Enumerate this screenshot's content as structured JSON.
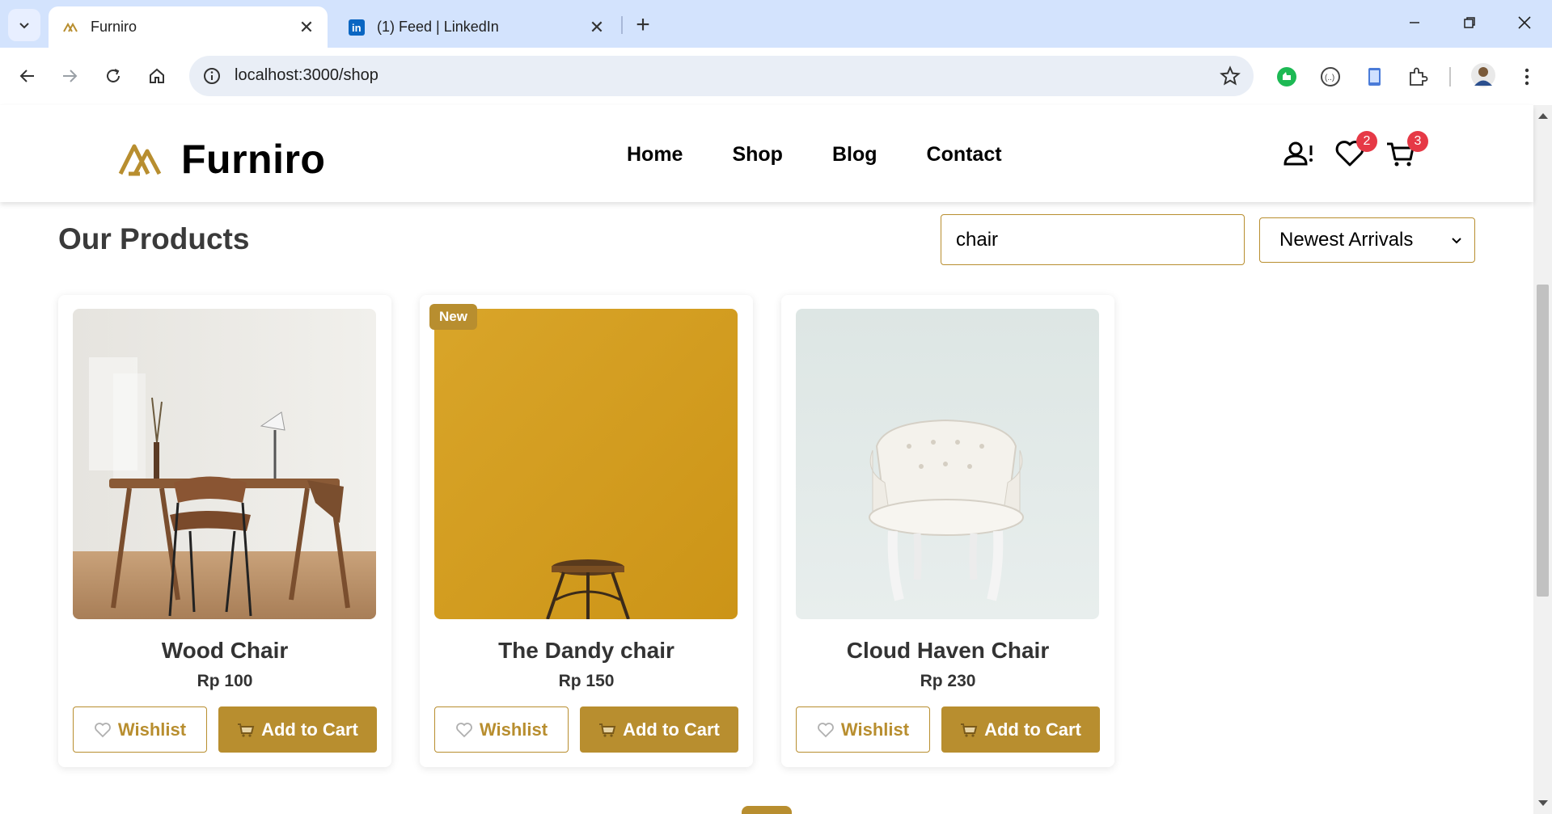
{
  "browser": {
    "tabs": [
      {
        "title": "Furniro",
        "active": true
      },
      {
        "title": "(1) Feed | LinkedIn",
        "active": false
      }
    ],
    "url": "localhost:3000/shop"
  },
  "site": {
    "brand": "Furniro",
    "nav": [
      "Home",
      "Shop",
      "Blog",
      "Contact"
    ],
    "wishlist_count": "2",
    "cart_count": "3"
  },
  "shop": {
    "title": "Our Products",
    "search_value": "chair",
    "sort_selected": "Newest Arrivals",
    "wishlist_label": "Wishlist",
    "add_to_cart_label": "Add to Cart",
    "products": [
      {
        "name": "Wood Chair",
        "price": "Rp 100",
        "badge": ""
      },
      {
        "name": "The Dandy chair",
        "price": "Rp 150",
        "badge": "New"
      },
      {
        "name": "Cloud Haven Chair",
        "price": "Rp 230",
        "badge": ""
      }
    ]
  },
  "colors": {
    "accent": "#b88e2f",
    "badge_red": "#e63946",
    "tabbar_bg": "#d3e3fd"
  }
}
